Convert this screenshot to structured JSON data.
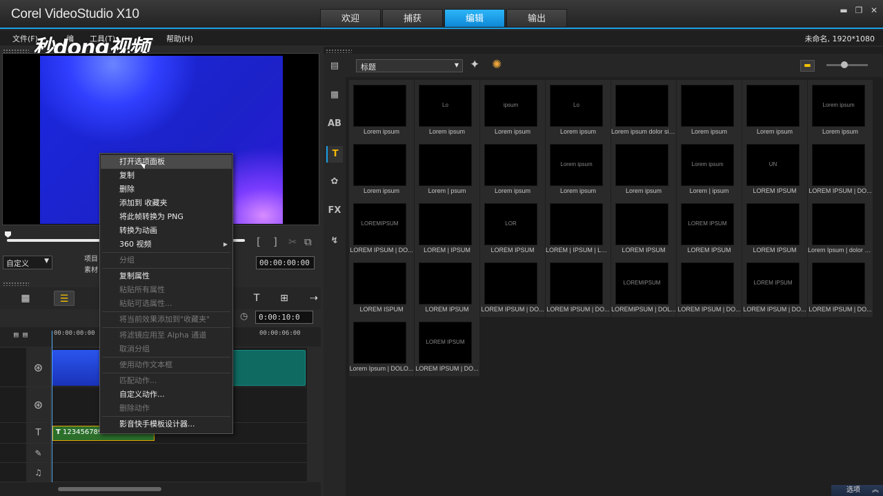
{
  "app": {
    "title": "Corel VideoStudio X10",
    "project": "未命名, 1920*1080"
  },
  "main_tabs": [
    {
      "label": "欢迎"
    },
    {
      "label": "捕获"
    },
    {
      "label": "编辑"
    },
    {
      "label": "输出"
    }
  ],
  "active_tab": "编辑",
  "menu": {
    "file": "文件(F)",
    "edit": "编",
    "tools": "工具(T)",
    "help": "帮助(H)"
  },
  "watermark": "秒dong视频",
  "preview": {
    "mode": "自定义",
    "label_project": "项目",
    "label_clip": "素材",
    "timecode": "00:00:00:00",
    "scrub_progress": 0,
    "mark_in": "[",
    "mark_out": "]"
  },
  "timeline": {
    "duration": "0:00:10:0",
    "ruler_start": "00:00:00:00",
    "ruler_mid": "00:00:06:00",
    "title_clip": "123456789"
  },
  "context_menu": {
    "items": [
      {
        "label": "打开选项面板",
        "enabled": true,
        "hover": true
      },
      {
        "label": "复制",
        "enabled": true
      },
      {
        "label": "删除",
        "enabled": true
      },
      {
        "label": "添加到 收藏夹",
        "enabled": true
      },
      {
        "label": "将此帧转换为 PNG",
        "enabled": true
      },
      {
        "label": "转换为动画",
        "enabled": true
      },
      {
        "label": "360 视频",
        "enabled": true,
        "submenu": true
      },
      {
        "label": "分组",
        "enabled": false
      },
      {
        "label": "复制属性",
        "enabled": true
      },
      {
        "label": "粘贴所有属性",
        "enabled": false
      },
      {
        "label": "粘贴可选属性...",
        "enabled": false
      },
      {
        "label": "将当前效果添加到\"收藏夹\"",
        "enabled": false
      },
      {
        "label": "将滤镜应用至 Alpha 通道",
        "enabled": false
      },
      {
        "label": "取消分组",
        "enabled": false
      },
      {
        "label": "使用动作文本框",
        "enabled": false
      },
      {
        "label": "匹配动作...",
        "enabled": false
      },
      {
        "label": "自定义动作...",
        "enabled": true
      },
      {
        "label": "删除动作",
        "enabled": false
      },
      {
        "label": "影音快手模板设计器...",
        "enabled": true
      }
    ]
  },
  "library": {
    "category": "标题",
    "side_icons": [
      "media-icon",
      "instant-project-icon",
      "transition-icon",
      "title-icon",
      "graphic-icon",
      "fx-icon",
      "path-icon"
    ],
    "thumbnails": [
      {
        "caption": "Lorem ipsum",
        "inner": ""
      },
      {
        "caption": "Lorem ipsum",
        "inner": "Lo"
      },
      {
        "caption": "Lorem ipsum",
        "inner": "ipsum"
      },
      {
        "caption": "Lorem ipsum",
        "inner": "Lo"
      },
      {
        "caption": "Lorem ipsum dolor sit ...",
        "inner": ""
      },
      {
        "caption": "Lorem ipsum",
        "inner": ""
      },
      {
        "caption": "Lorem ipsum",
        "inner": ""
      },
      {
        "caption": "Lorem ipsum",
        "inner": "Lorem ipsum"
      },
      {
        "caption": "Lorem ipsum",
        "inner": ""
      },
      {
        "caption": "Lorem | psum",
        "inner": ""
      },
      {
        "caption": "Lorem ipsum",
        "inner": ""
      },
      {
        "caption": "Lorem ipsum",
        "inner": "Lorem ipsum"
      },
      {
        "caption": "Lorem ipsum",
        "inner": ""
      },
      {
        "caption": "Lorem | ipsum",
        "inner": "Lorem ipsum"
      },
      {
        "caption": "LOREM IPSUM",
        "inner": "UN"
      },
      {
        "caption": "LOREM IPSUM | DO...",
        "inner": ""
      },
      {
        "caption": "LOREM IPSUM | DO...",
        "inner": "LOREMIPSUM"
      },
      {
        "caption": "LOREM | IPSUM",
        "inner": ""
      },
      {
        "caption": "LOREM IPSUM",
        "inner": "LOR"
      },
      {
        "caption": "LOREM | IPSUM | LO...",
        "inner": ""
      },
      {
        "caption": "LOREM IPSUM",
        "inner": ""
      },
      {
        "caption": "LOREM IPSUM",
        "inner": "LOREM IPSUM"
      },
      {
        "caption": "LOREM IPSUM",
        "inner": ""
      },
      {
        "caption": "Lorem Ipsum | dolor s...",
        "inner": ""
      },
      {
        "caption": "LOREM ISPUM",
        "inner": ""
      },
      {
        "caption": "LOREM IPSUM",
        "inner": ""
      },
      {
        "caption": "LOREM IPSUM | DO...",
        "inner": ""
      },
      {
        "caption": "LOREM IPSUM | DO...",
        "inner": ""
      },
      {
        "caption": "LOREMIPSUM | DOL...",
        "inner": "LOREMIPSUM"
      },
      {
        "caption": "LOREM IPSUM | DO...",
        "inner": ""
      },
      {
        "caption": "LOREM IPSUM | DO...",
        "inner": "LOREM IPSUM"
      },
      {
        "caption": "LOREM IPSUM | DO...",
        "inner": ""
      },
      {
        "caption": "Lorem Ipsum | DOLO...",
        "inner": ""
      },
      {
        "caption": "LOREM IPSUM | DO...",
        "inner": "LOREM IPSUM"
      }
    ]
  },
  "options_button": "选项"
}
